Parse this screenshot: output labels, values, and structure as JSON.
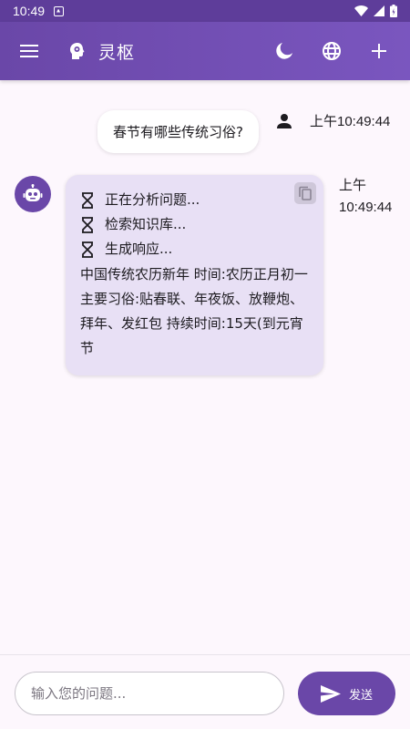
{
  "status_bar": {
    "time": "10:49"
  },
  "app_bar": {
    "title": "灵枢"
  },
  "messages": {
    "user": {
      "text": "春节有哪些传统习俗?",
      "time": "上午10:49:44"
    },
    "bot": {
      "time": "上午10:49:44",
      "status_lines": [
        "正在分析问题...",
        "检索知识库...",
        "生成响应..."
      ],
      "answer": "中国传统农历新年 时间:农历正月初一 主要习俗:贴春联、年夜饭、放鞭炮、拜年、发红包 持续时间:15天(到元宵节"
    }
  },
  "input": {
    "placeholder": "输入您的问题..."
  },
  "send_button": {
    "label": "发送"
  },
  "colors": {
    "primary": "#6a47a8",
    "status_bar": "#5e3d9a",
    "bot_bubble": "#e8e0f5",
    "background": "#fdf7fd"
  },
  "icons": [
    "menu-icon",
    "brain-gear-icon",
    "dark-mode-icon",
    "globe-icon",
    "add-icon",
    "person-icon",
    "robot-icon",
    "hourglass-icon",
    "copy-icon",
    "send-icon",
    "wifi-icon",
    "signal-icon",
    "battery-icon"
  ]
}
